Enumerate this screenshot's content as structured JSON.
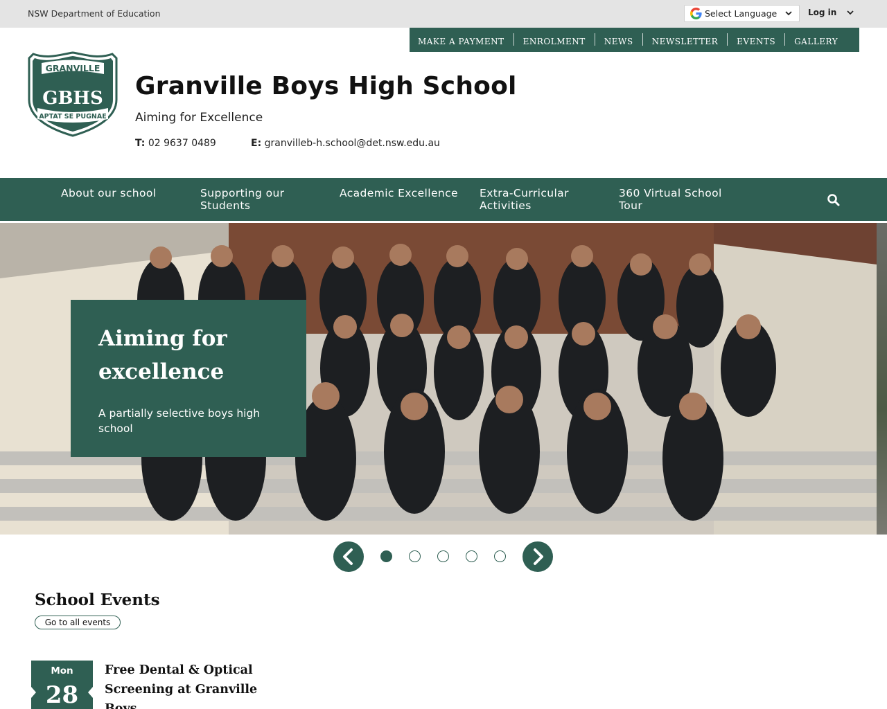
{
  "topbar": {
    "department": "NSW Department of Education",
    "language_label": "Select Language",
    "login_label": "Log in"
  },
  "utility_nav": {
    "items": [
      "MAKE A PAYMENT",
      "ENROLMENT",
      "NEWS",
      "NEWSLETTER",
      "EVENTS",
      "GALLERY"
    ]
  },
  "header": {
    "crest_top_text": "GRANVILLE",
    "crest_monogram": "GBHS",
    "crest_motto": "APTAT SE PUGNAE",
    "school_name": "Granville Boys High School",
    "tagline": "Aiming for Excellence",
    "phone_label": "T:",
    "phone": "02 9637 0489",
    "email_label": "E:",
    "email": "granvilleb-h.school@det.nsw.edu.au"
  },
  "main_nav": {
    "items": [
      {
        "line1": "About our school",
        "line2": ""
      },
      {
        "line1": "Supporting our",
        "line2": "Students"
      },
      {
        "line1": "Academic Excellence",
        "line2": ""
      },
      {
        "line1": "Extra-Curricular",
        "line2": "Activities"
      },
      {
        "line1": "360 Virtual School",
        "line2": "Tour"
      }
    ]
  },
  "hero": {
    "title_line1": "Aiming for",
    "title_line2": "excellence",
    "subtitle_line1": "A partially selective boys high",
    "subtitle_line2": "school"
  },
  "carousel": {
    "slide_count": 5,
    "active_index": 0
  },
  "events": {
    "section_title": "School Events",
    "all_events_label": "Go to all events",
    "items": [
      {
        "day_of_week": "Mon",
        "day": "28",
        "title_line1": "Free Dental & Optical",
        "title_line2": "Screening at Granville",
        "title_line3": "Boys"
      }
    ]
  },
  "colors": {
    "brand_green": "#2f5f53",
    "topbar_gray": "#e4e4e4"
  }
}
